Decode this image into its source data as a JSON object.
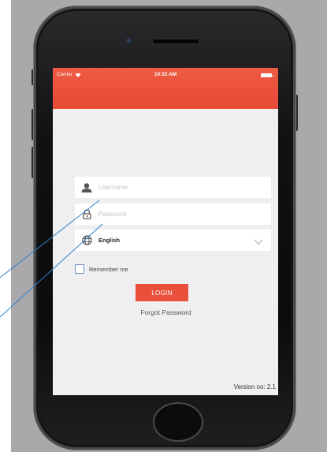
{
  "status_bar": {
    "carrier": "Carrier",
    "time": "10:32 AM"
  },
  "login_form": {
    "username": {
      "placeholder": "Username",
      "value": ""
    },
    "password": {
      "placeholder": "Password",
      "value": ""
    },
    "language": {
      "selected": "English"
    },
    "remember_me": {
      "label": "Remember me",
      "checked": false
    },
    "login_button": "LOGIN",
    "forgot_password": "Forgot Password"
  },
  "version": "Version no: 2.1",
  "colors": {
    "brand_red": "#e84a36",
    "screen_bg": "#efeff1",
    "annotation_line": "#2d7fc9"
  }
}
